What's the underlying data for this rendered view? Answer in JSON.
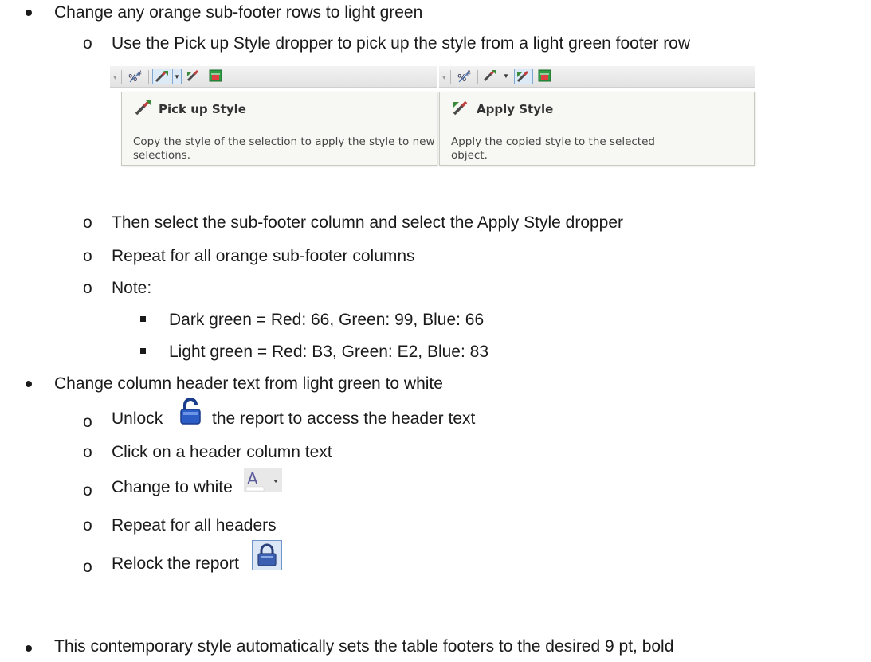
{
  "section1": {
    "bullet": "Change any orange sub-footer rows to light green",
    "sub1": "Use the Pick up Style dropper to pick up the style from a light green footer row",
    "pick_popup": {
      "title": "Pick up Style",
      "desc": "Copy the style of the selection to apply the style to new selections."
    },
    "apply_popup": {
      "title": "Apply Style",
      "desc": "Apply the copied style to the selected object."
    },
    "sub2": "Then select the sub-footer column and select the Apply Style dropper",
    "sub3": "Repeat for all orange sub-footer columns",
    "sub4": "Note:",
    "note1": "Dark green = Red: 66, Green: 99, Blue: 66",
    "note2": "Light green = Red: B3, Green: E2, Blue: 83"
  },
  "section2": {
    "bullet": "Change column header text from light green to white",
    "unlock_pre": "Unlock",
    "unlock_post": "the report to access the header text",
    "click": "Click on a header column text",
    "change": "Change to white",
    "repeat": "Repeat for all headers",
    "relock": "Relock the report"
  },
  "section3": {
    "bullet": "This contemporary style automatically sets the table footers to the desired 9 pt, bold"
  },
  "icons": [
    "percent-icon",
    "pick-up-style-icon",
    "apply-style-icon",
    "chart-icon",
    "unlock-icon",
    "font-color-icon",
    "lock-icon"
  ]
}
